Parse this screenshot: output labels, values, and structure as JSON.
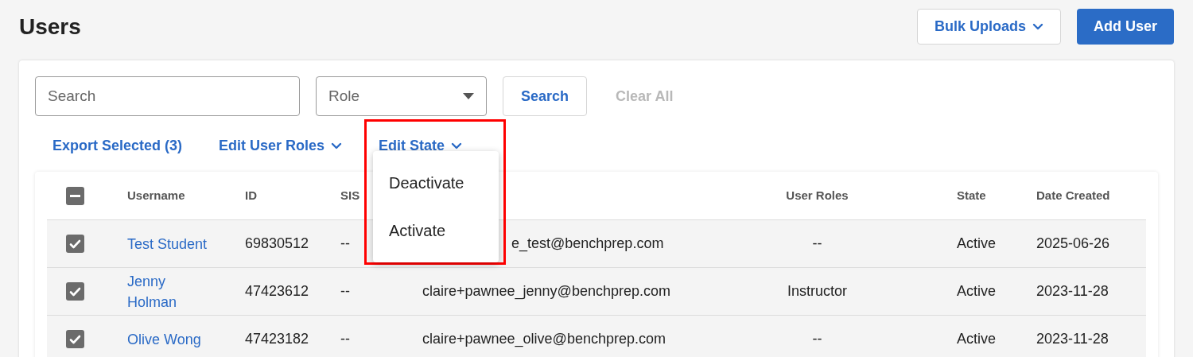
{
  "page": {
    "title": "Users"
  },
  "header_buttons": [
    {
      "label": "Bulk Uploads",
      "kind": "dropdown"
    },
    {
      "label": "Add User",
      "kind": "primary"
    }
  ],
  "filters": {
    "search": {
      "placeholder": "Search"
    },
    "role": {
      "placeholder": "Role"
    },
    "search_button": "Search",
    "clear_button": {
      "label": "Clear All",
      "disabled": true
    }
  },
  "actions": [
    {
      "label": "Export Selected (3)",
      "kind": "link"
    },
    {
      "label": "Edit User Roles",
      "kind": "dropdown"
    },
    {
      "label": "Edit State",
      "kind": "dropdown"
    }
  ],
  "menu": {
    "items": [
      "Deactivate",
      "Activate"
    ],
    "highlighted": true
  },
  "table": {
    "select_all": {
      "indeterminate": true
    },
    "columns": [
      "Username",
      "ID",
      "SIS",
      "",
      "User Roles",
      "State",
      "Date Created"
    ],
    "rows": [
      {
        "checked": true,
        "username": "Test Student",
        "id": "69830512",
        "sis_id": "--",
        "email": "e_test@benchprep.com",
        "email_covered": true,
        "roles": "--",
        "state": "Active",
        "created": "2025-06-26"
      },
      {
        "checked": true,
        "username": "Jenny Holman",
        "id": "47423612",
        "sis_id": "--",
        "email": "claire+pawnee_jenny@benchprep.com",
        "email_covered": false,
        "roles": "Instructor",
        "state": "Active",
        "created": "2023-11-28"
      },
      {
        "checked": true,
        "username": "Olive Wong",
        "id": "47423182",
        "sis_id": "--",
        "email": "claire+pawnee_olive@benchprep.com",
        "email_covered": false,
        "roles": "--",
        "state": "Active",
        "created": "2023-11-28"
      }
    ]
  }
}
